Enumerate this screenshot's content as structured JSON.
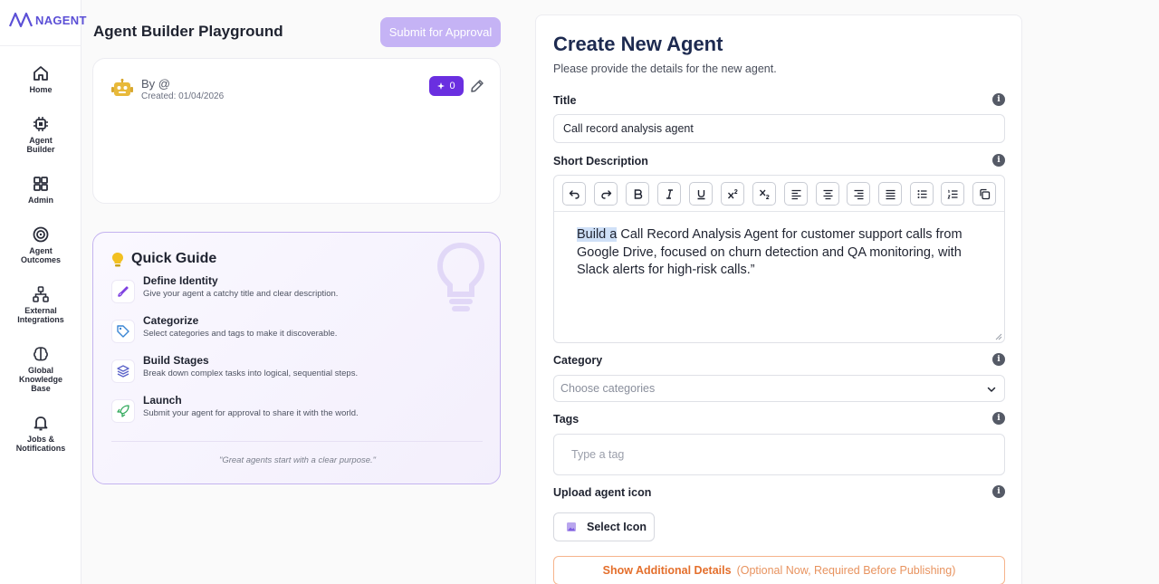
{
  "brand": {
    "name": "NAGENT",
    "color": "#5b4fd6"
  },
  "sidebar": {
    "items": [
      {
        "label": "Home",
        "icon": "home-icon"
      },
      {
        "label": "Agent\nBuilder",
        "icon": "agent-builder-icon"
      },
      {
        "label": "Admin",
        "icon": "admin-grid-icon"
      },
      {
        "label": "Agent\nOutcomes",
        "icon": "target-icon"
      },
      {
        "label": "External\nIntegrations",
        "icon": "integrations-icon"
      },
      {
        "label": "Global\nKnowledge\nBase",
        "icon": "brain-icon"
      },
      {
        "label": "Jobs &\nNotifications",
        "icon": "bell-icon"
      }
    ]
  },
  "header": {
    "title": "Agent Builder Playground",
    "submit_label": "Submit for Approval"
  },
  "agent_card": {
    "by": "By @",
    "created": "Created: 01/04/2026",
    "badge_count": "0"
  },
  "quick_guide": {
    "title": "Quick Guide",
    "steps": [
      {
        "title": "Define Identity",
        "desc": "Give your agent a catchy title and clear description.",
        "icon": "brush-icon"
      },
      {
        "title": "Categorize",
        "desc": "Select categories and tags to make it discoverable.",
        "icon": "tag-icon"
      },
      {
        "title": "Build Stages",
        "desc": "Break down complex tasks into logical, sequential steps.",
        "icon": "layers-icon"
      },
      {
        "title": "Launch",
        "desc": "Submit your agent for approval to share it with the world.",
        "icon": "rocket-icon"
      }
    ],
    "quote": "\"Great agents start with a clear purpose.\""
  },
  "form": {
    "title": "Create New Agent",
    "subtitle": "Please provide the details for the new agent.",
    "title_label": "Title",
    "title_value": "Call record analysis agent",
    "desc_label": "Short Description",
    "desc_selected": "Build a",
    "desc_rest": " Call Record Analysis Agent for customer support calls from Google Drive, focused on churn detection and QA monitoring, with Slack alerts for high-risk calls.”",
    "category_label": "Category",
    "category_placeholder": "Choose categories",
    "tags_label": "Tags",
    "tags_placeholder": "Type a tag",
    "icon_label": "Upload agent icon",
    "select_icon_label": "Select Icon",
    "show_details": "Show Additional Details",
    "show_details_note": "(Optional Now, Required Before Publishing)",
    "info_glyph": "i"
  },
  "colors": {
    "accent": "#6a2fe0",
    "submit_disabled": "#c5b3f5",
    "orange": "#e46f2c"
  }
}
